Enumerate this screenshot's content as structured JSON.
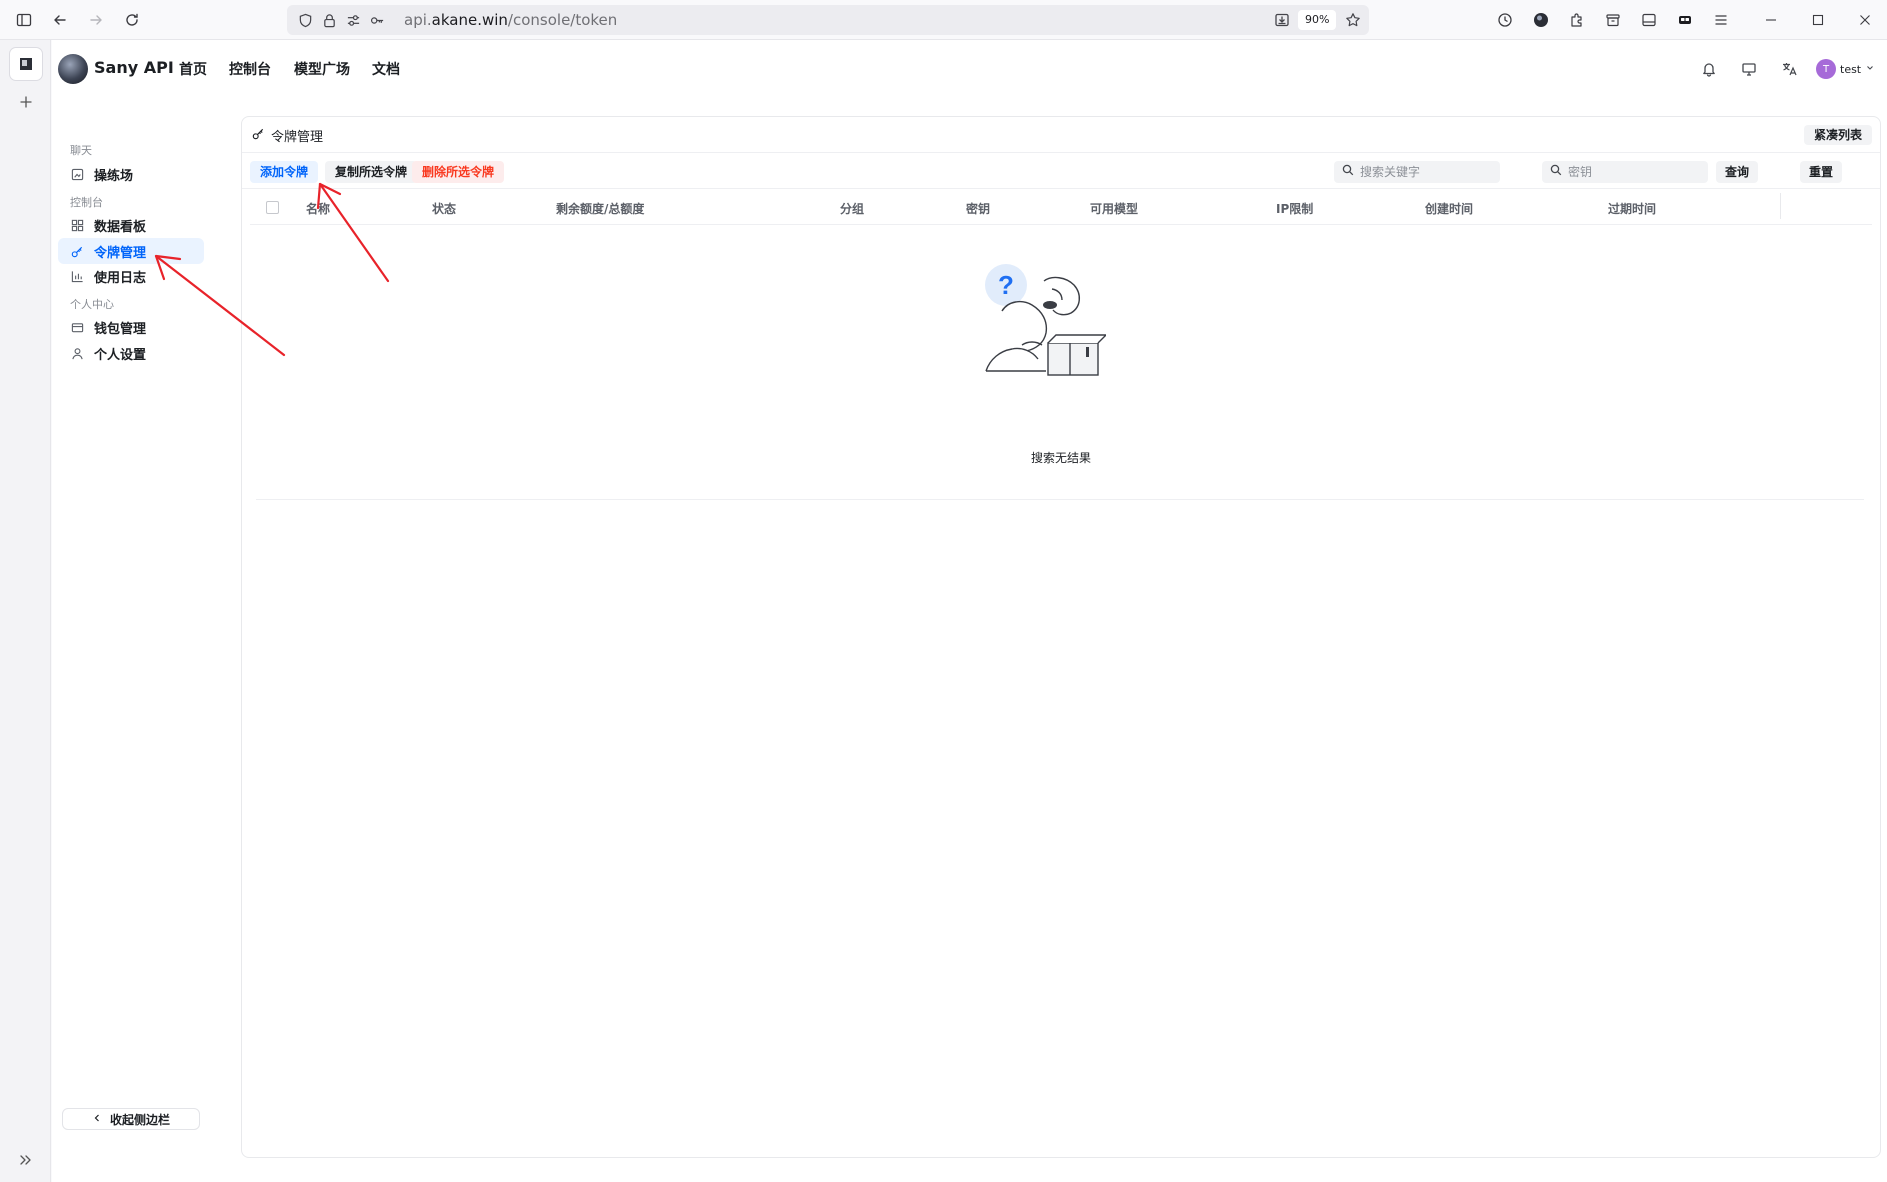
{
  "browser": {
    "url_prefix": "api.",
    "url_host": "akane.win",
    "url_path": "/console/token",
    "zoom": "90%"
  },
  "app": {
    "brand": "Sany API",
    "nav": [
      "首页",
      "控制台",
      "模型广场",
      "文档"
    ],
    "user": {
      "initial": "T",
      "name": "test"
    }
  },
  "sidebar": {
    "sections": [
      {
        "title": "聊天",
        "items": [
          {
            "label": "操练场",
            "icon": "playground-icon"
          }
        ]
      },
      {
        "title": "控制台",
        "items": [
          {
            "label": "数据看板",
            "icon": "dashboard-icon"
          },
          {
            "label": "令牌管理",
            "icon": "key-icon",
            "active": true
          },
          {
            "label": "使用日志",
            "icon": "chart-icon"
          }
        ]
      },
      {
        "title": "个人中心",
        "items": [
          {
            "label": "钱包管理",
            "icon": "wallet-icon"
          },
          {
            "label": "个人设置",
            "icon": "user-icon"
          }
        ]
      }
    ],
    "collapse_label": "收起侧边栏"
  },
  "card": {
    "title": "令牌管理",
    "compact_label": "紧凑列表",
    "toolbar": {
      "add": "添加令牌",
      "copy": "复制所选令牌",
      "delete": "删除所选令牌",
      "keyword_placeholder": "搜索关键字",
      "key_placeholder": "密钥",
      "query": "查询",
      "reset": "重置"
    },
    "columns": [
      "名称",
      "状态",
      "剩余额度/总额度",
      "分组",
      "密钥",
      "可用模型",
      "IP限制",
      "创建时间",
      "过期时间"
    ],
    "empty_text": "搜索无结果"
  },
  "colors": {
    "accent": "#0064fa",
    "danger": "#f93920",
    "annotation": "#e8232a"
  }
}
